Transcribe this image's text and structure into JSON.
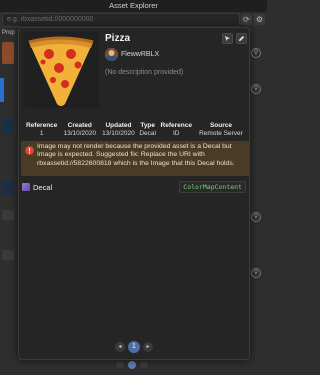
{
  "window": {
    "title": "Asset Explorer"
  },
  "background": {
    "search_placeholder": "e.g. rbxassetid://000000000",
    "left_tab": "Prop",
    "page": "1"
  },
  "asset": {
    "name": "Pizza",
    "creator": "FlewwRBLX",
    "description": "(No description provided)"
  },
  "info_table": {
    "headers": [
      "Reference",
      "Created",
      "Updated",
      "Type",
      "Reference",
      "Source"
    ],
    "values": [
      "1",
      "13/10/2020",
      "13/10/2020",
      "Decal",
      "ID",
      "Remote Server"
    ]
  },
  "warning": {
    "text": "Image may not render because the provided asset is a Decal but Image is expected. Suggested fix: Replace the URI with rbxassetid://5822600818 which is the Image that this Decal holds."
  },
  "decal": {
    "label": "Decal",
    "property": "ColorMapContent"
  },
  "pagination": {
    "current": "1"
  },
  "colors": {
    "accent": "#4d6fa3",
    "warning_bg": "#4a3b26",
    "property_green": "#79d27a"
  }
}
